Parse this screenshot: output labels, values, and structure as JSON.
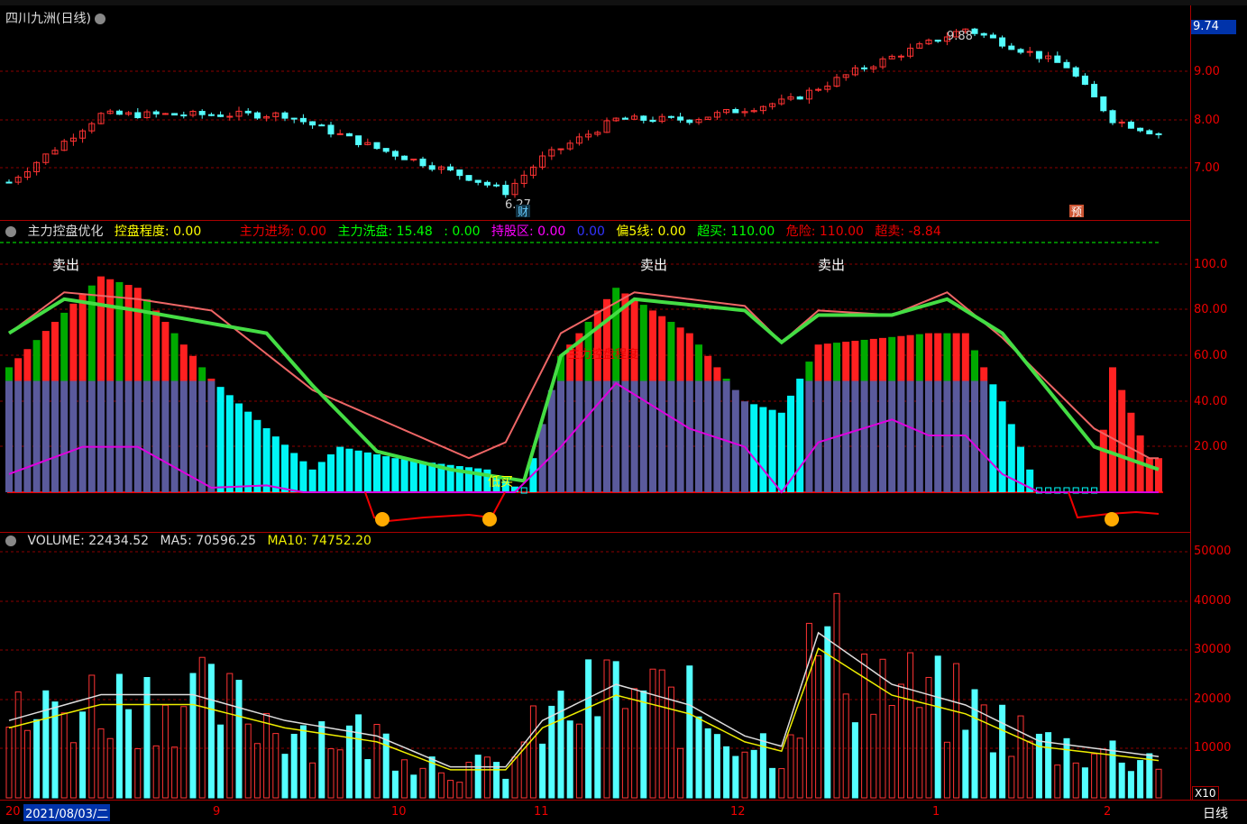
{
  "top": {
    "stock_title": "四川九洲(日线)",
    "hi_label": "9.88",
    "lo_label": "6.27",
    "tag_cai": "财",
    "tag_yu": "预",
    "price_badge": "9.74"
  },
  "yaxis_top": [
    "9.00",
    "8.00",
    "7.00"
  ],
  "ind": {
    "name": "主力控盘优化",
    "l1": "控盘程度: 0.00",
    "l2": "主力进场: 0.00",
    "l3": "主力洗盘: 15.48",
    "l4": ": 0.00",
    "l5": "持股区: 0.00",
    "l6": "0.00",
    "l7": "偏5线: 0.00",
    "l8": "超买: 110.00",
    "l9": "危险: 110.00",
    "l10": "超卖: -8.84",
    "sell1": "卖出",
    "sell2": "卖出",
    "sell3": "卖出",
    "buy": "低买",
    "mid_text": "主力控盘程度"
  },
  "yaxis_ind": [
    "100.0",
    "80.00",
    "60.00",
    "40.00",
    "20.00"
  ],
  "vol": {
    "l1": "VOLUME: 22434.52",
    "l2": "MA5: 70596.25",
    "l3": "MA10: 74752.20"
  },
  "yaxis_vol": [
    "50000",
    "40000",
    "30000",
    "20000",
    "10000"
  ],
  "x10": "X10",
  "bottom": {
    "date_label": "2021/08/03/二",
    "yr": "20",
    "m9": "9",
    "m10": "10",
    "m11": "11",
    "m12": "12",
    "m1": "1",
    "m2": "2",
    "period": "日线"
  },
  "colors": {
    "up": "#ff3333",
    "down": "#54ffff",
    "bg": "#000000",
    "grid": "#8b0000"
  }
}
